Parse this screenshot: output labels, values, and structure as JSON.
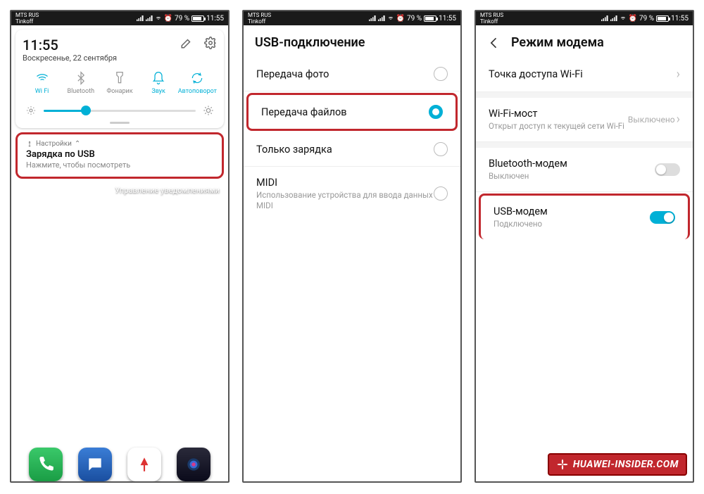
{
  "statusbar": {
    "carrier1": "MTS RUS",
    "carrier2": "Tinkoff",
    "battery": "79 %",
    "time": "11:55"
  },
  "phone1": {
    "time": "11:55",
    "date": "Воскресенье, 22 сентября",
    "qs": {
      "wifi": "Wi Fi",
      "bluetooth": "Bluetooth",
      "flashlight": "Фонарик",
      "sound": "Звук",
      "autorotate": "Автоповорот"
    },
    "notif": {
      "app": "Настройки",
      "title": "Зарядка по USB",
      "sub": "Нажмите, чтобы посмотреть"
    },
    "manage": "Управление уведомлениями"
  },
  "phone2": {
    "title": "USB-подключение",
    "options": {
      "photo": "Передача фото",
      "files": "Передача файлов",
      "charge": "Только зарядка",
      "midi": "MIDI",
      "midi_sub": "Использование устройства для ввода данных MIDI"
    }
  },
  "phone3": {
    "title": "Режим модема",
    "rows": {
      "hotspot": "Точка доступа Wi-Fi",
      "bridge": "Wi-Fi-мост",
      "bridge_sub": "Открыт доступ к текущей сети Wi-Fi",
      "bridge_state": "Выключено",
      "bt": "Bluetooth-модем",
      "bt_sub": "Выключен",
      "usb": "USB-модем",
      "usb_sub": "Подключено"
    }
  },
  "watermark": "HUAWEI-INSIDER.COM"
}
